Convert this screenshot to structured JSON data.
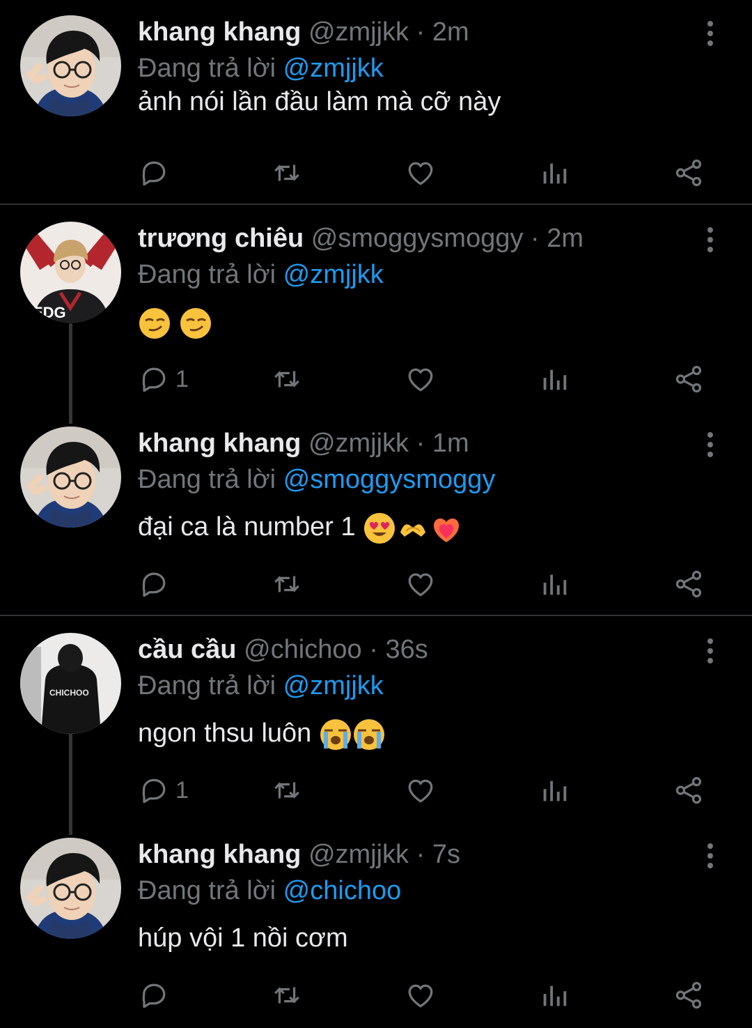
{
  "tweets": [
    {
      "name": "khang khang",
      "handle": "@zmjjkk",
      "sep": " · ",
      "time": "2m",
      "reply_prefix": "Đang trả lời ",
      "reply_to": "@zmjjkk",
      "text": "ảnh nói lần đầu làm mà cỡ này",
      "reply_count": ""
    },
    {
      "name": "trương chiêu",
      "handle": "@smoggysmoggy",
      "sep": " · ",
      "time": "2m",
      "reply_prefix": "Đang trả lời ",
      "reply_to": "@zmjjkk",
      "text": "",
      "reply_count": "1"
    },
    {
      "name": "khang khang",
      "handle": "@zmjjkk",
      "sep": " · ",
      "time": "1m",
      "reply_prefix": "Đang trả lời ",
      "reply_to": "@smoggysmoggy",
      "text": "đại ca là number 1 ",
      "reply_count": ""
    },
    {
      "name": "cầu cầu",
      "handle": "@chichoo",
      "sep": " · ",
      "time": "36s",
      "reply_prefix": "Đang trả lời ",
      "reply_to": "@zmjjkk",
      "text": "ngon thsu luôn ",
      "reply_count": "1"
    },
    {
      "name": "khang khang",
      "handle": "@zmjjkk",
      "sep": " · ",
      "time": "7s",
      "reply_prefix": "Đang trả lời ",
      "reply_to": "@chichoo",
      "text": "húp vội 1 nồi cơm",
      "reply_count": ""
    }
  ],
  "colors": {
    "background": "#000000",
    "text": "#e7e9ea",
    "muted": "#71767b",
    "link": "#1d9bf0",
    "divider": "#2f3336"
  },
  "icons": [
    "reply-icon",
    "retweet-icon",
    "like-icon",
    "views-icon",
    "share-icon",
    "more-icon"
  ]
}
